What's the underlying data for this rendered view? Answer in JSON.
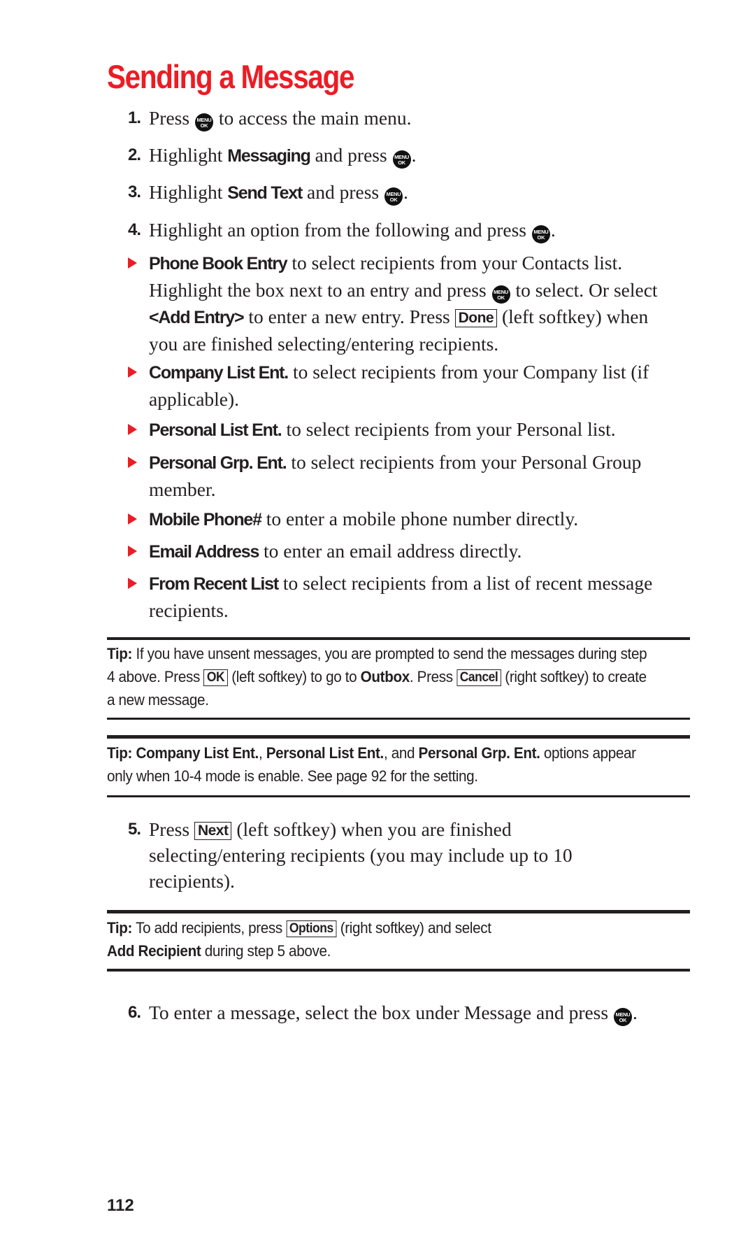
{
  "title": "Sending a Message",
  "steps": [
    {
      "num": "1.",
      "pre": "Press",
      "post": "to access the main menu."
    },
    {
      "num": "2.",
      "pre": "Highlight",
      "bold": "Messaging",
      "mid": "and press",
      "post": "."
    },
    {
      "num": "3.",
      "pre": "Highlight",
      "bold": "Send Text",
      "mid": "and press",
      "post": "."
    },
    {
      "num": "4.",
      "pre": "Highlight an option from the following and press",
      "post": "."
    },
    {
      "num": "5.",
      "pre": "Press",
      "key": "Next",
      "post": "(left softkey) when you are finished selecting/entering recipients (you may include up to 10 recipients)."
    },
    {
      "num": "6.",
      "pre": "To enter a message, select the box under Message and press",
      "post": "."
    }
  ],
  "options": [
    {
      "bold": "Phone Book Entry",
      "text1": "to select recipients from your Contacts list. Highlight the box next to an entry and press",
      "text2": "to select. Or select",
      "bold2": "<Add Entry>",
      "text3": "to enter a new entry. Press",
      "key": "Done",
      "text4": "(left softkey) when you are finished selecting/entering recipients."
    },
    {
      "bold": "Company List Ent.",
      "text": "to select recipients from your Company list (if applicable)."
    },
    {
      "bold": "Personal List Ent.",
      "text": "to select recipients from your Personal list."
    },
    {
      "bold": "Personal Grp. Ent.",
      "text": "to select recipients from your Personal Group member."
    },
    {
      "bold": "Mobile Phone#",
      "text": "to enter a mobile phone number directly."
    },
    {
      "bold": "Email Address",
      "text": "to enter an email address directly."
    },
    {
      "bold": "From Recent List",
      "text": "to select recipients from a list of recent message recipients."
    }
  ],
  "menu_key": {
    "line1": "MENU",
    "line2": "OK",
    "icon": "menu-ok-key-icon"
  },
  "tips": [
    {
      "label": "Tip:",
      "t1": "If you have unsent messages, you are prompted to send the messages during step 4 above. Press",
      "key1": "OK",
      "t2": "(left softkey) to go to",
      "bold1": "Outbox",
      "t3": ". Press",
      "key2": "Cancel",
      "t4": "(right softkey) to create a new message."
    },
    {
      "label": "Tip:",
      "bold1": "Company List Ent.",
      "t1": ",",
      "bold2": "Personal List Ent.",
      "t2": ", and",
      "bold3": "Personal Grp. Ent.",
      "t3": "options appear only when 10-4 mode is enable. See page 92 for the setting."
    },
    {
      "label": "Tip:",
      "t1": "To add recipients, press",
      "key1": "Options",
      "t2": "(right softkey) and select",
      "bold1": "Add Recipient",
      "t3": "during step 5 above."
    }
  ],
  "page_number": "112"
}
